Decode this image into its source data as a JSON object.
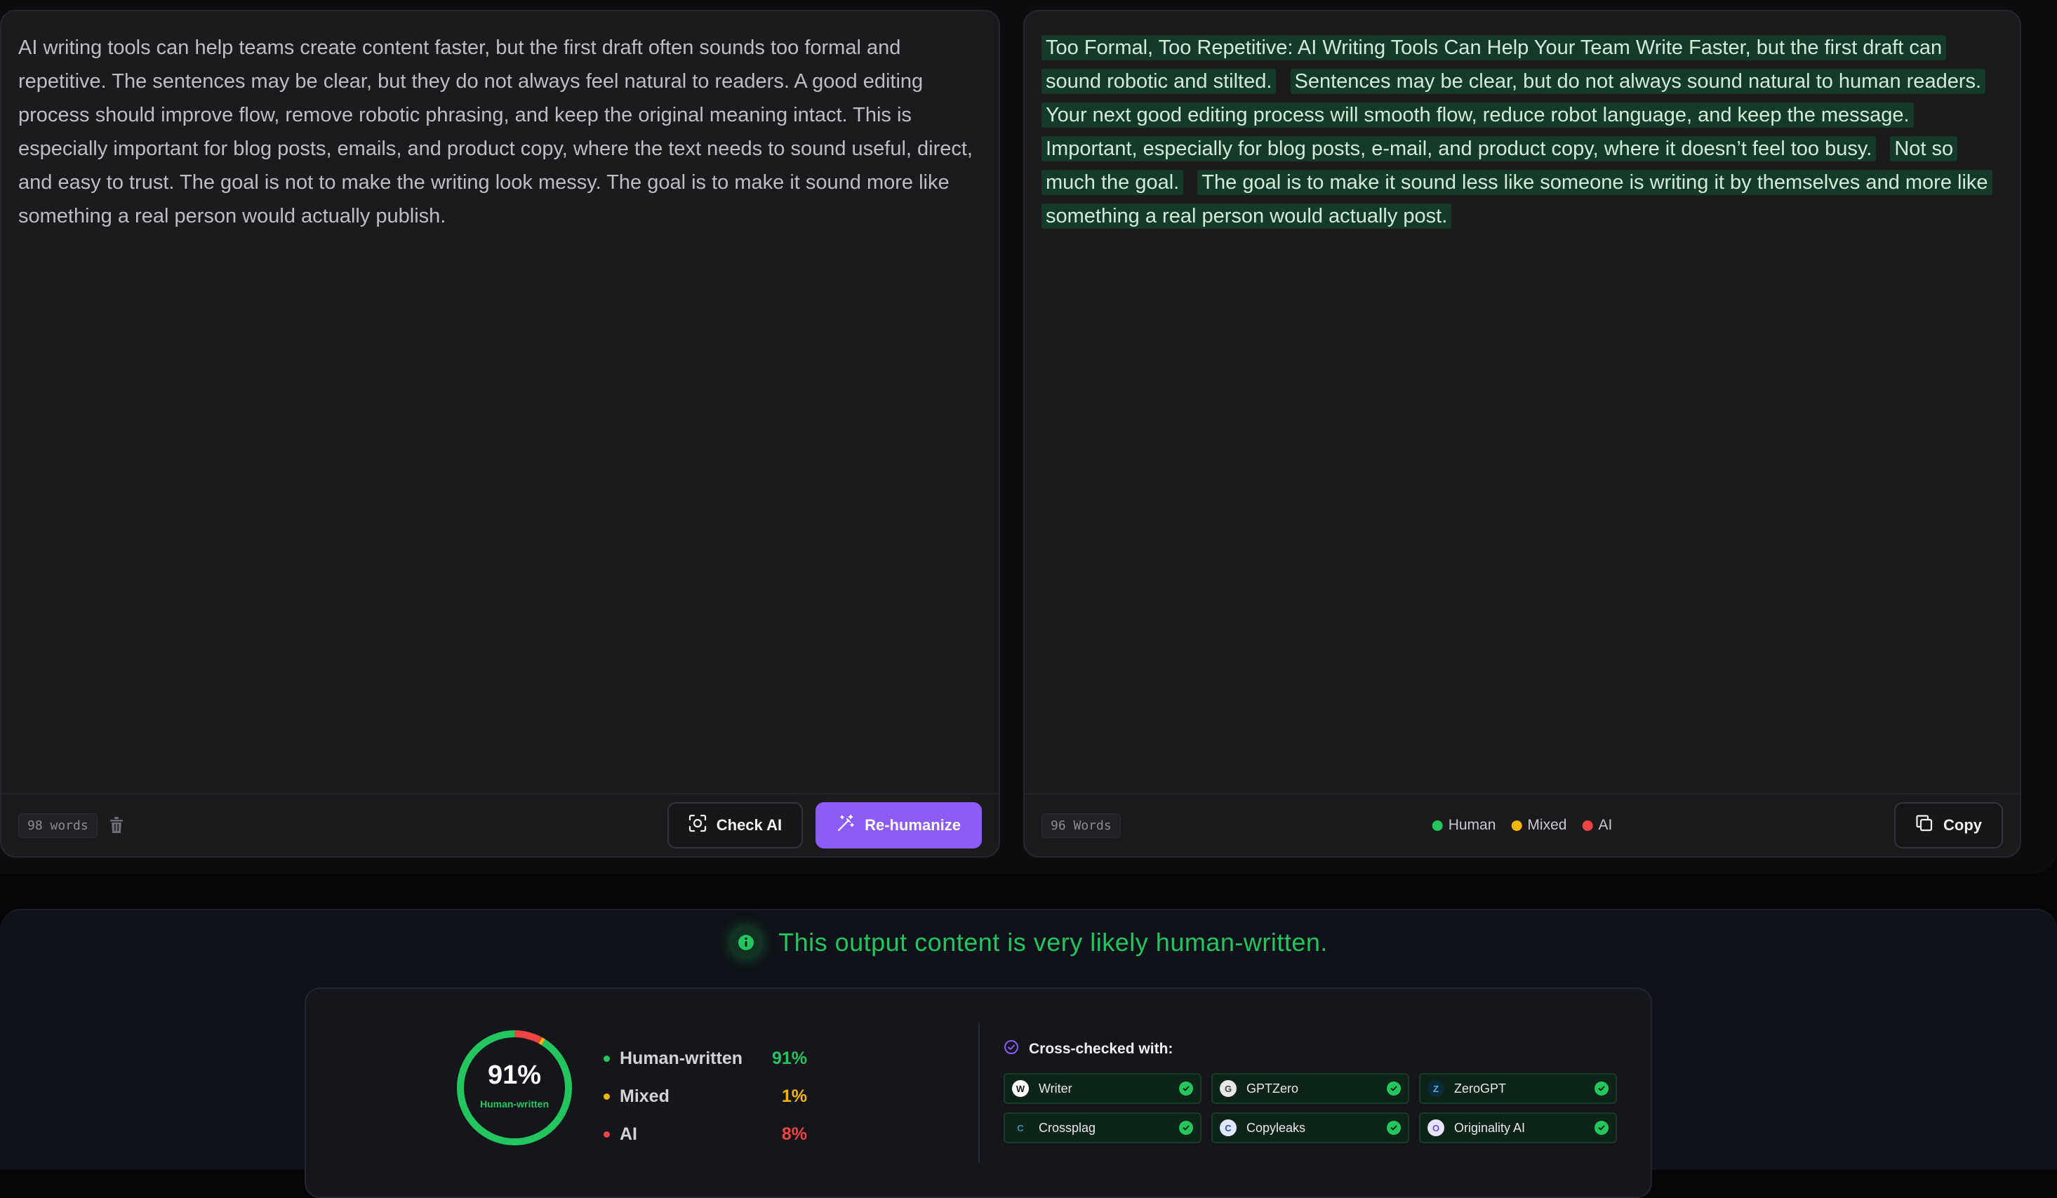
{
  "input": {
    "text": "AI writing tools can help teams create content faster, but the first draft often sounds too formal and repetitive. The sentences may be clear, but they do not always feel natural to readers. A good editing process should improve flow, remove robotic phrasing, and keep the original meaning intact. This is especially important for blog posts, emails, and product copy, where the text needs to sound useful, direct, and easy to trust. The goal is not to make the writing look messy. The goal is to make it sound more like something a real person would actually publish.",
    "word_count": "98 words",
    "trash_icon": "trash-icon"
  },
  "actions": {
    "check_label": "Check AI",
    "check_icon": "scan-icon",
    "humanize_label": "Re-humanize",
    "humanize_icon": "magic-wand-icon"
  },
  "output": {
    "segments": [
      "Too Formal, Too Repetitive: AI Writing Tools Can Help Your Team Write Faster, but the first draft can sound robotic and stilted.",
      "Sentences may be clear, but do not always sound natural to human readers.",
      "Your next good editing process will smooth flow, reduce robot language, and keep the message.",
      "Important, especially for blog posts, e-mail, and product copy, where it doesn’t feel too busy.",
      "Not so much the goal.",
      "The goal is to make it sound less like someone is writing it by themselves and more like something a real person would actually post."
    ],
    "word_count": "96 Words",
    "legend": [
      {
        "label": "Human",
        "color": "#22c55e"
      },
      {
        "label": "Mixed",
        "color": "#f5b400"
      },
      {
        "label": "AI",
        "color": "#ef4444"
      }
    ],
    "copy_label": "Copy",
    "copy_icon": "copy-icon"
  },
  "result": {
    "verdict": "This output content is very likely human-written.",
    "verdict_icon": "info-icon",
    "gauge": {
      "percent": "91%",
      "label": "Human-written",
      "human": 91,
      "mixed": 1,
      "ai": 8
    },
    "stats": [
      {
        "name": "Human-written",
        "value": "91%",
        "color": "#22c55e"
      },
      {
        "name": "Mixed",
        "value": "1%",
        "color": "#f5b400"
      },
      {
        "name": "AI",
        "value": "8%",
        "color": "#ef4444"
      }
    ],
    "cross_title": "Cross-checked with:",
    "cross_icon": "check-circle-icon",
    "detectors": [
      {
        "name": "Writer",
        "logo": "W"
      },
      {
        "name": "GPTZero",
        "logo": "G"
      },
      {
        "name": "ZeroGPT",
        "logo": "Z"
      },
      {
        "name": "Crossplag",
        "logo": "C"
      },
      {
        "name": "Copyleaks",
        "logo": "C"
      },
      {
        "name": "Originality AI",
        "logo": "O"
      }
    ]
  },
  "colors": {
    "accent": "#8b5cf6",
    "human": "#22c55e",
    "mixed": "#f5b400",
    "ai": "#ef4444"
  }
}
